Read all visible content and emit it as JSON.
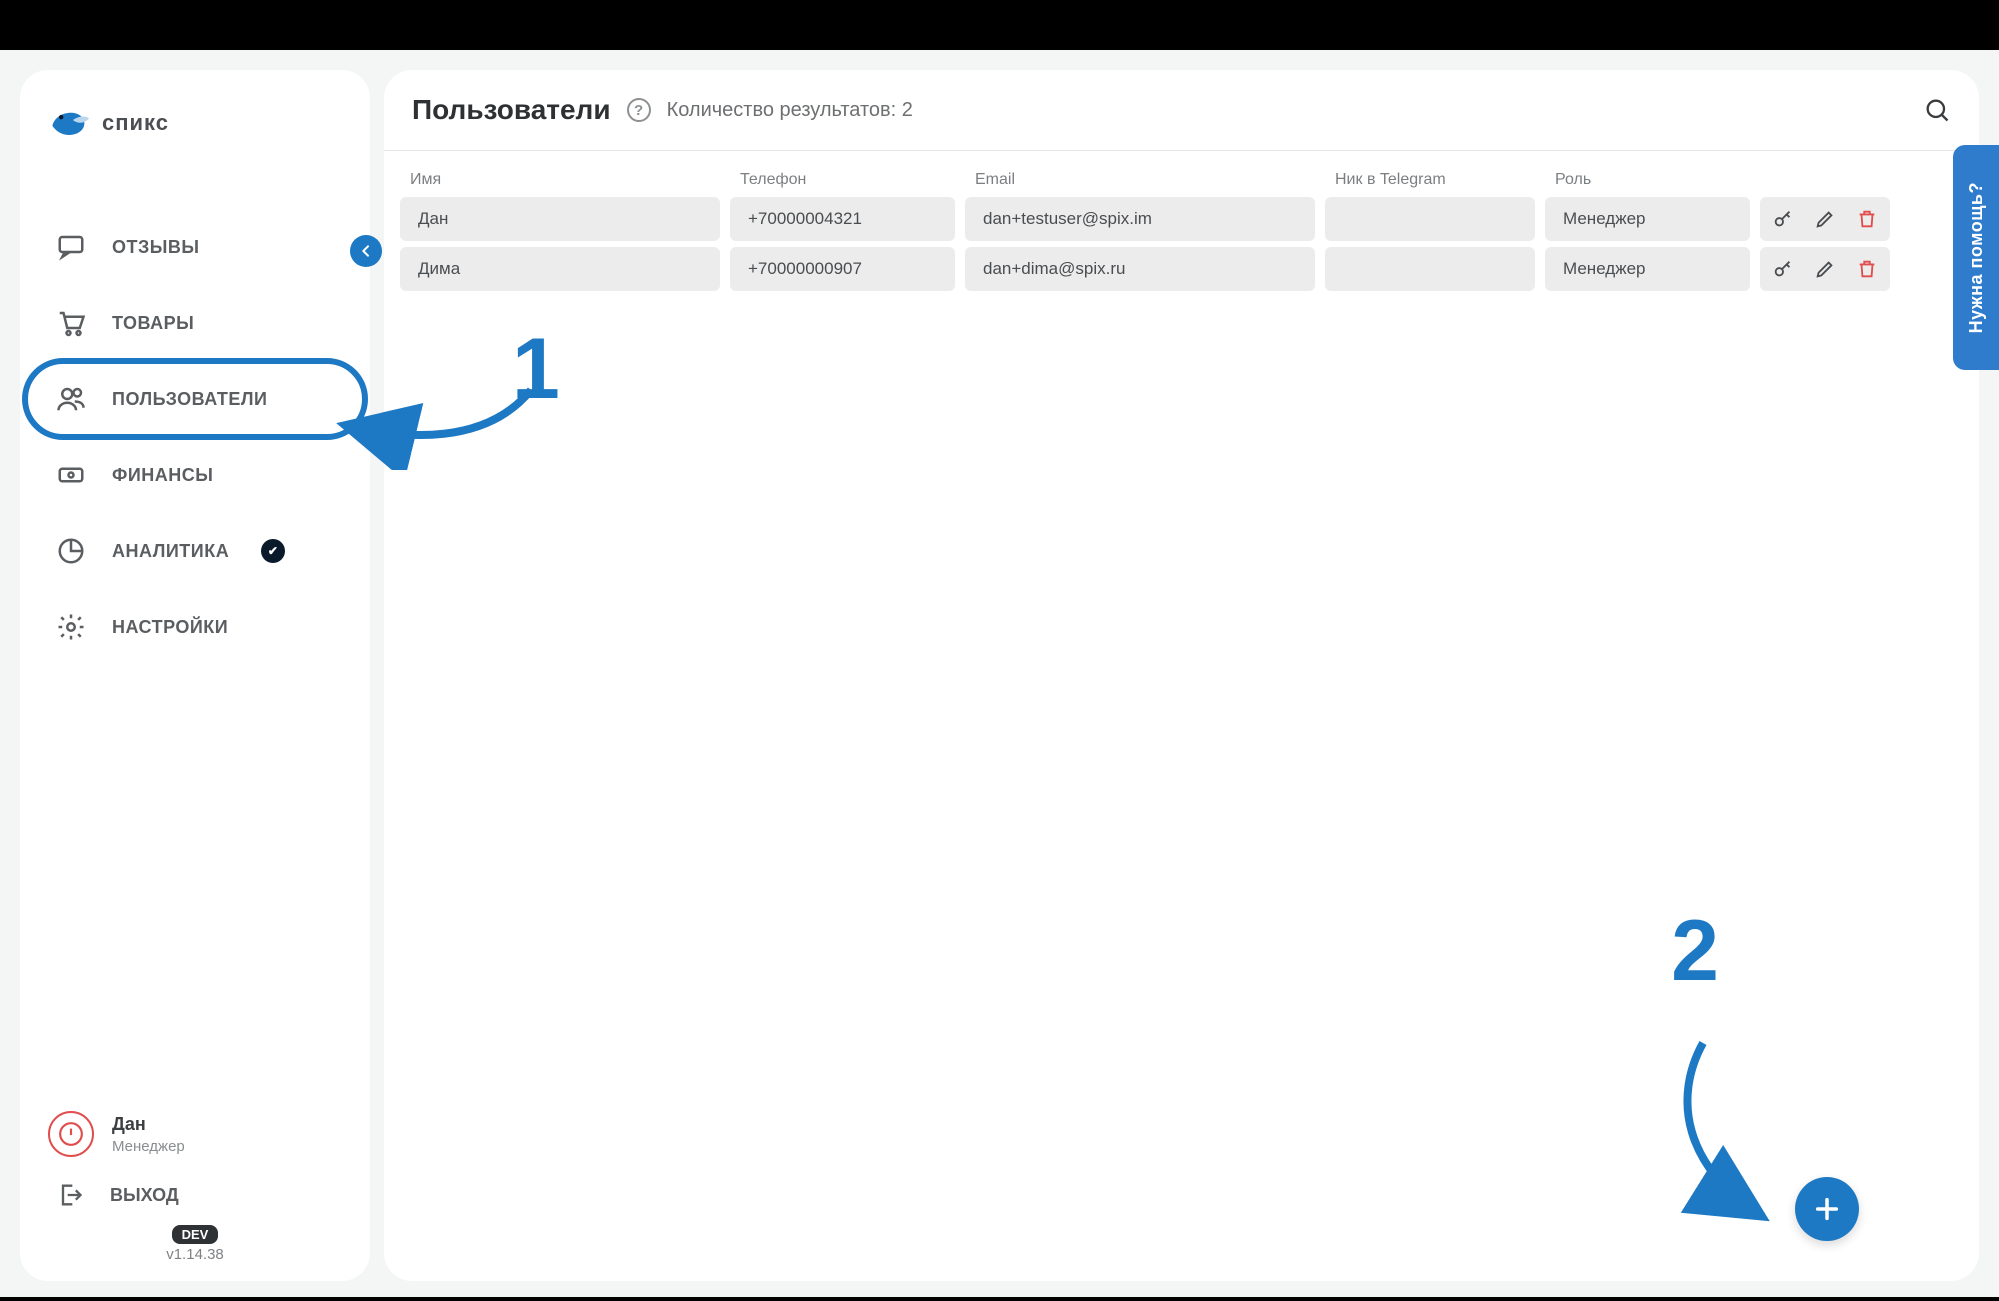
{
  "brand": {
    "name": "спикс"
  },
  "sidebar": {
    "items": [
      {
        "label": "ОТЗЫВЫ"
      },
      {
        "label": "ТОВАРЫ"
      },
      {
        "label": "ПОЛЬЗОВАТЕЛИ"
      },
      {
        "label": "ФИНАНСЫ"
      },
      {
        "label": "АНАЛИТИКА"
      },
      {
        "label": "НАСТРОЙКИ"
      }
    ],
    "user": {
      "name": "Дан",
      "role": "Менеджер"
    },
    "logout": "ВЫХОД",
    "dev_pill": "DEV",
    "version": "v1.14.38"
  },
  "header": {
    "title": "Пользователи",
    "results_label": "Количество результатов: 2"
  },
  "table": {
    "columns": {
      "name": "Имя",
      "phone": "Телефон",
      "email": "Email",
      "telegram": "Ник в Telegram",
      "role": "Роль"
    },
    "rows": [
      {
        "name": "Дан",
        "phone": "+70000004321",
        "email": "dan+testuser@spix.im",
        "telegram": "",
        "role": "Менеджер"
      },
      {
        "name": "Дима",
        "phone": "+70000000907",
        "email": "dan+dima@spix.ru",
        "telegram": "",
        "role": "Менеджер"
      }
    ]
  },
  "help_tab": "Нужна помощь?",
  "annotations": {
    "one": "1",
    "two": "2"
  },
  "colors": {
    "accent": "#1e79c4",
    "danger": "#e14c4c"
  }
}
